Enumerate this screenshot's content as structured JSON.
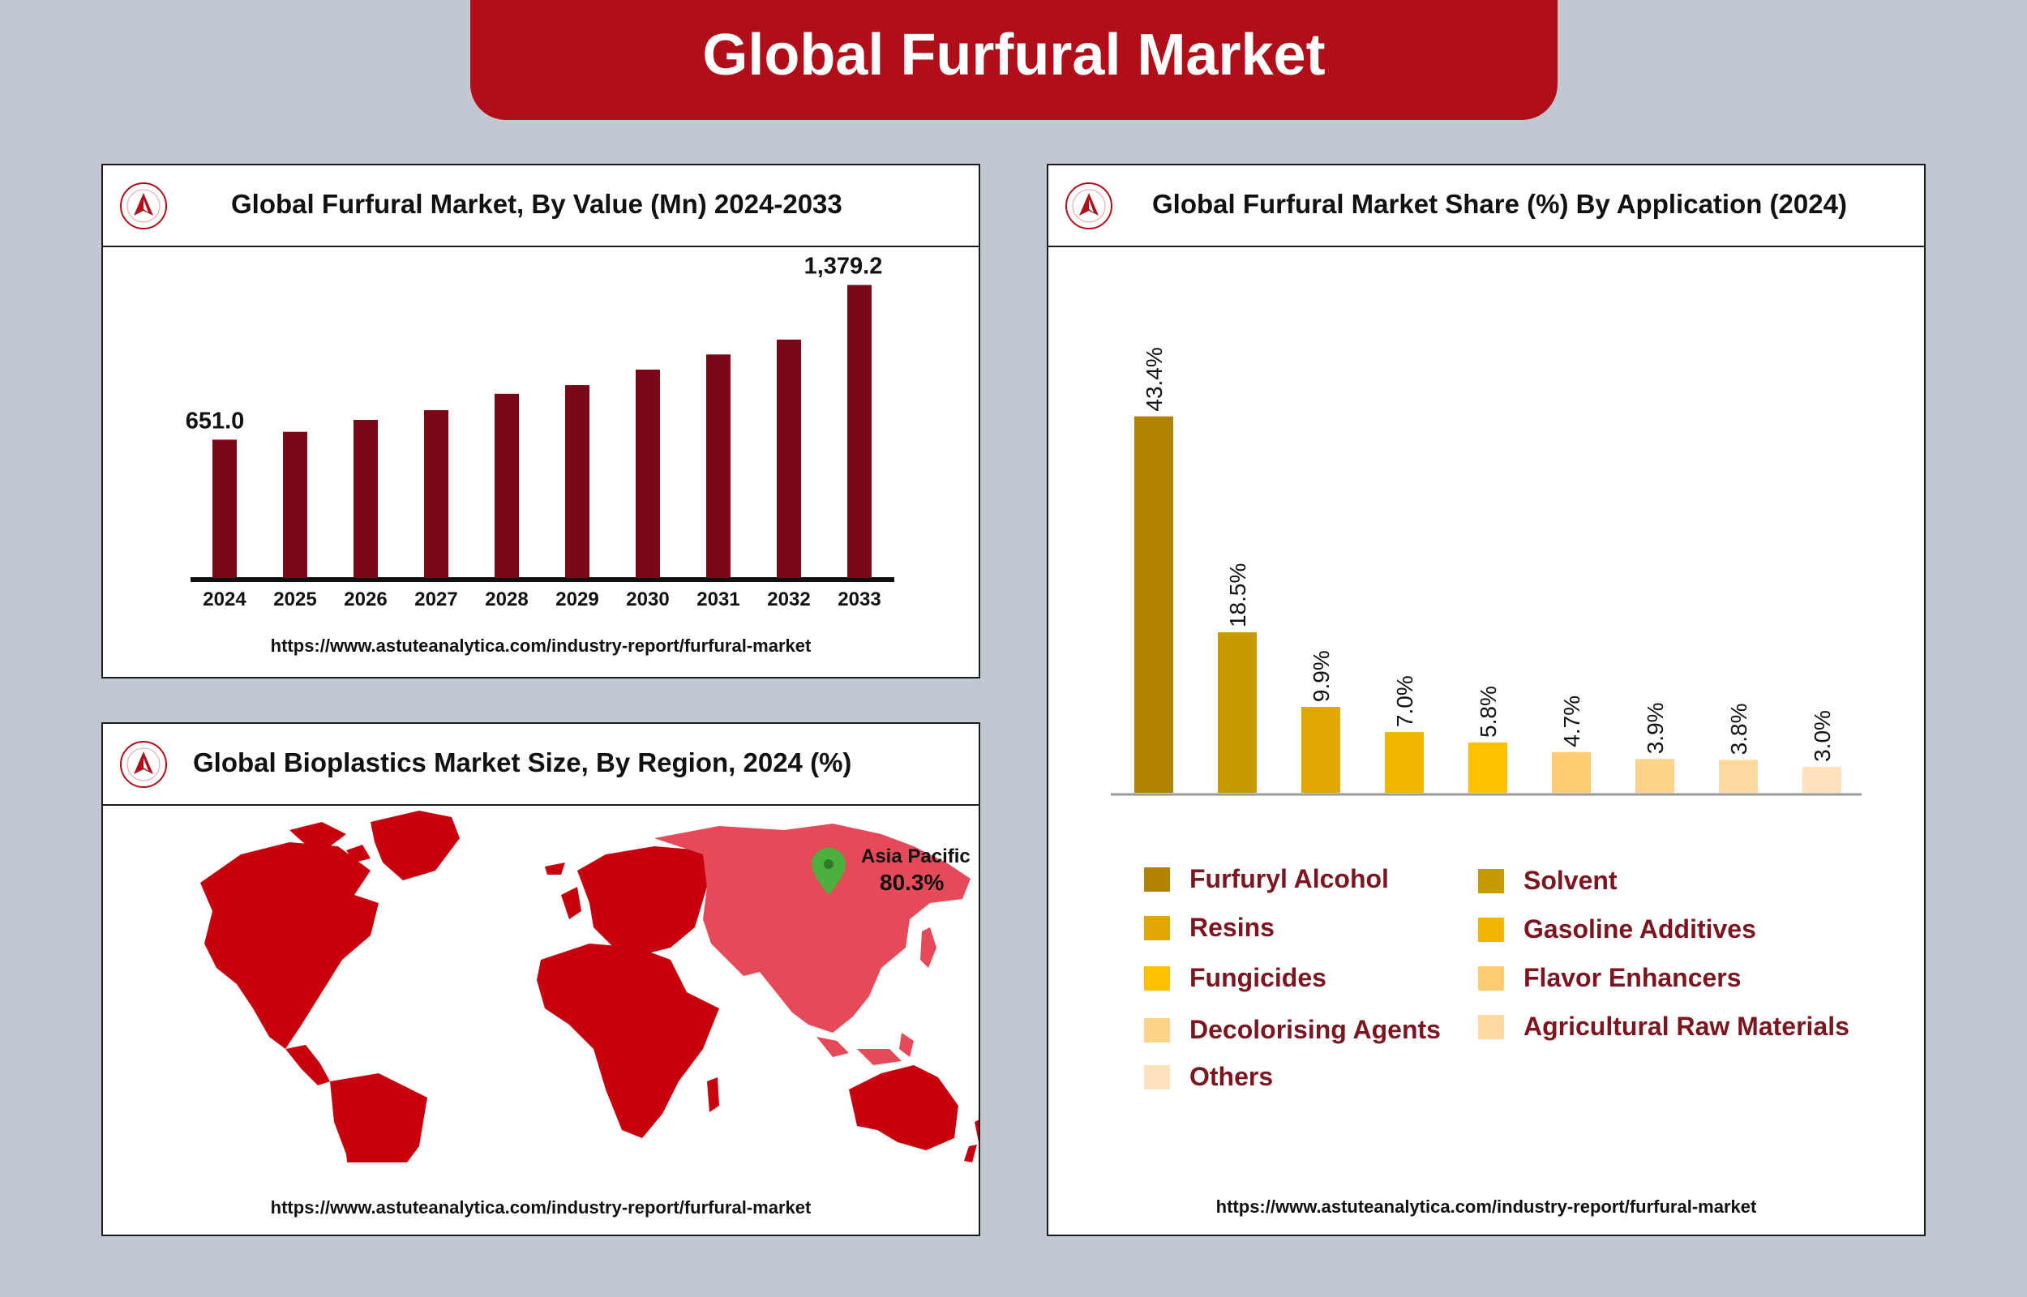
{
  "header": {
    "title": "Global Furfural Market"
  },
  "panels": {
    "value": {
      "title": "Global Furfural Market, By Value (Mn) 2024-2033",
      "url": "https://www.astuteanalytica.com/industry-report/furfural-market"
    },
    "region": {
      "title": "Global Bioplastics Market Size, By Region, 2024 (%)",
      "url": "https://www.astuteanalytica.com/industry-report/furfural-market",
      "callout_label": "Asia Pacific",
      "callout_value": "80.3%"
    },
    "application": {
      "title": "Global Furfural Market Share (%) By Application (2024)",
      "url": "https://www.astuteanalytica.com/industry-report/furfural-market"
    }
  },
  "chart_data": [
    {
      "type": "bar",
      "title": "Global Furfural Market, By Value (Mn) 2024-2033",
      "categories": [
        "2024",
        "2025",
        "2026",
        "2027",
        "2028",
        "2029",
        "2030",
        "2031",
        "2032",
        "2033"
      ],
      "values": [
        651.0,
        688,
        744,
        790,
        867,
        908,
        981,
        1052,
        1122,
        1379.2
      ],
      "data_labels": {
        "0": "651.0",
        "9": "1,379.2"
      },
      "color": "#7a0817",
      "ylim": [
        0,
        1450
      ],
      "grid": false
    },
    {
      "type": "bar",
      "title": "Global Furfural Market Share (%) By Application (2024)",
      "categories": [
        "Furfuryl Alcohol",
        "Solvent",
        "Resins",
        "Gasoline Additives",
        "Fungicides",
        "Flavor Enhancers",
        "Decolorising Agents",
        "Agricultural Raw Materials",
        "Others"
      ],
      "values": [
        43.4,
        18.5,
        9.9,
        7.0,
        5.8,
        4.7,
        3.9,
        3.8,
        3.0
      ],
      "value_labels": [
        "43.4%",
        "18.5%",
        "9.9%",
        "7.0%",
        "5.8%",
        "4.7%",
        "3.9%",
        "3.8%",
        "3.0%"
      ],
      "colors": [
        "#b08400",
        "#c99a00",
        "#e0a800",
        "#f1b500",
        "#ffc000",
        "#fdcc72",
        "#fdd38a",
        "#fdd8a0",
        "#fde2bd"
      ],
      "ylim": [
        0,
        50
      ],
      "grid": false,
      "legend_position": "bottom"
    }
  ]
}
